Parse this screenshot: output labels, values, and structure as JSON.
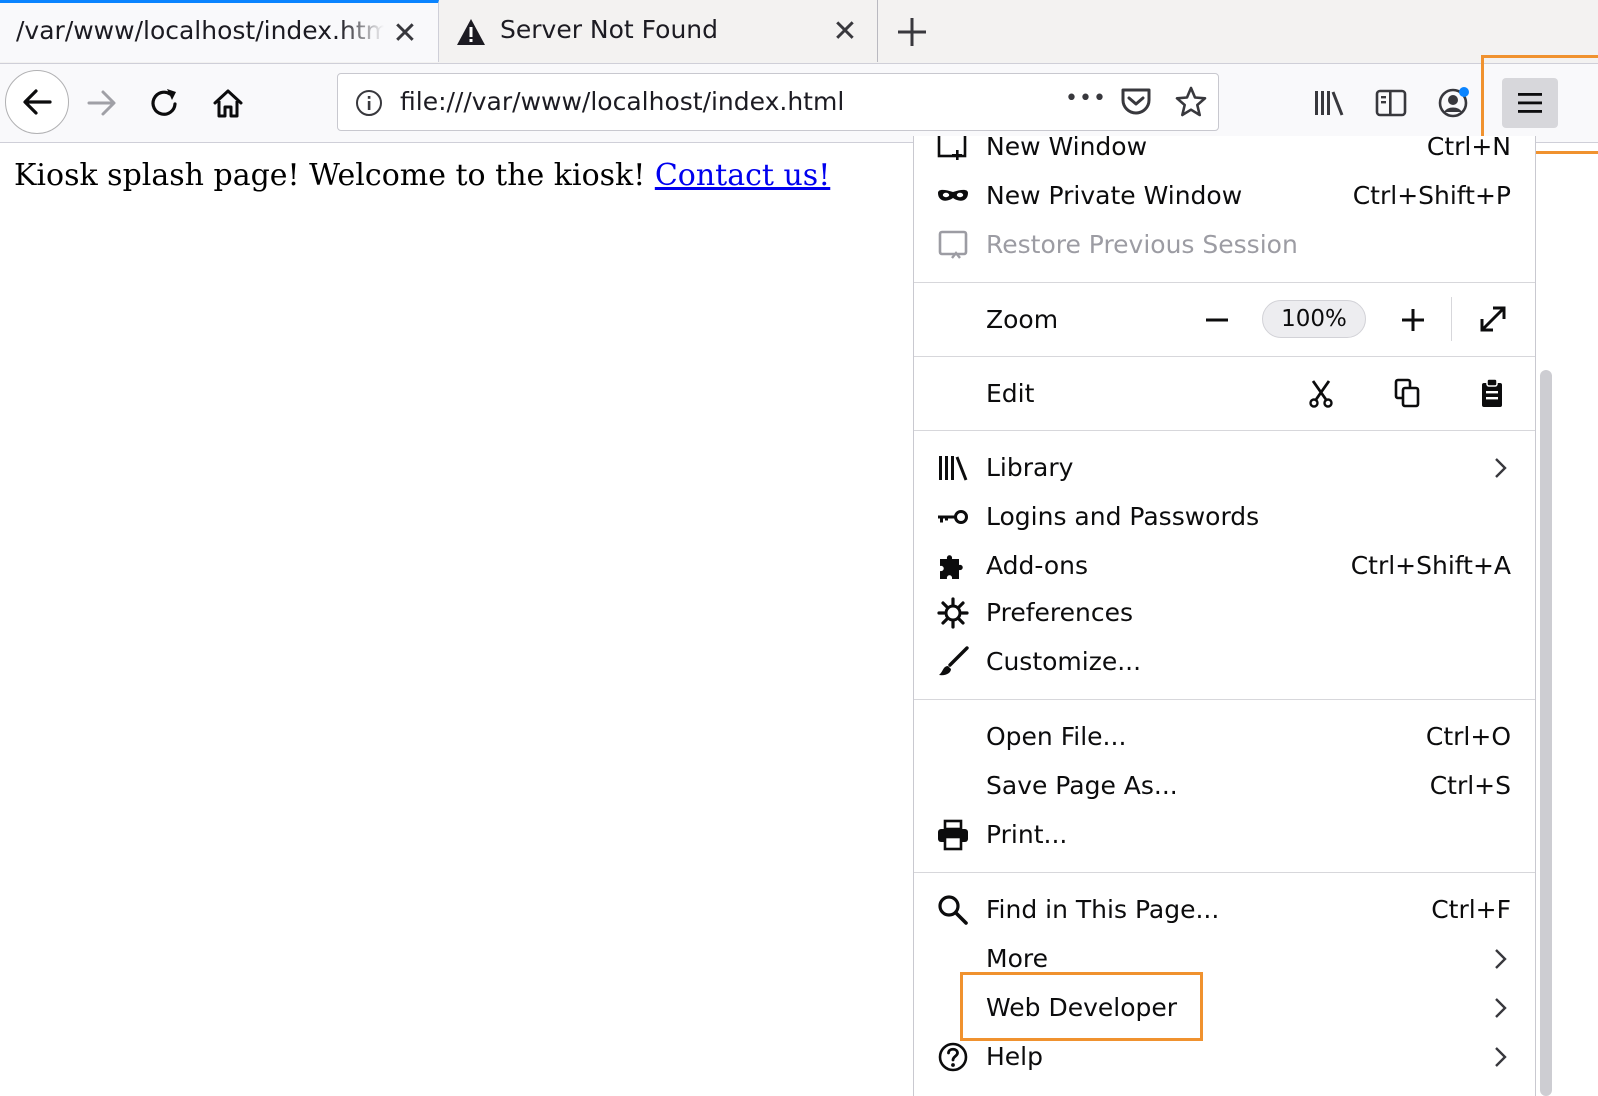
{
  "tabs": [
    {
      "title": "/var/www/localhost/index.html",
      "active": true,
      "close_glyph": "✕"
    },
    {
      "title": "Server Not Found",
      "active": false,
      "icon": "warning-icon",
      "close_glyph": "✕"
    }
  ],
  "toolbar": {
    "url": "file:///var/www/localhost/index.html",
    "icons": [
      "back-arrow-icon",
      "forward-arrow-icon",
      "reload-icon",
      "home-icon",
      "info-icon",
      "page-actions-icon",
      "pocket-icon",
      "bookmark-star-icon",
      "library-icon",
      "sidebar-icon",
      "account-icon",
      "hamburger-menu-icon"
    ],
    "overflow_glyph": "•••"
  },
  "page": {
    "text": "Kiosk splash page! Welcome to the kiosk! ",
    "link_text": "Contact us!"
  },
  "menu": {
    "new_window": {
      "label": "New Window",
      "shortcut": "Ctrl+N"
    },
    "private_window": {
      "label": "New Private Window",
      "shortcut": "Ctrl+Shift+P"
    },
    "restore_session": {
      "label": "Restore Previous Session"
    },
    "zoom": {
      "label": "Zoom",
      "value": "100%"
    },
    "edit": {
      "label": "Edit"
    },
    "library": {
      "label": "Library"
    },
    "logins": {
      "label": "Logins and Passwords"
    },
    "addons": {
      "label": "Add-ons",
      "shortcut": "Ctrl+Shift+A"
    },
    "preferences": {
      "label": "Preferences"
    },
    "customize": {
      "label": "Customize..."
    },
    "open_file": {
      "label": "Open File...",
      "shortcut": "Ctrl+O"
    },
    "save_page": {
      "label": "Save Page As...",
      "shortcut": "Ctrl+S"
    },
    "print": {
      "label": "Print..."
    },
    "find": {
      "label": "Find in This Page...",
      "shortcut": "Ctrl+F"
    },
    "more": {
      "label": "More"
    },
    "web_developer": {
      "label": "Web Developer"
    },
    "help": {
      "label": "Help"
    }
  },
  "colors": {
    "highlight": "#f0922f",
    "active_tab_accent": "#0a84ff",
    "link": "#0000ee"
  }
}
